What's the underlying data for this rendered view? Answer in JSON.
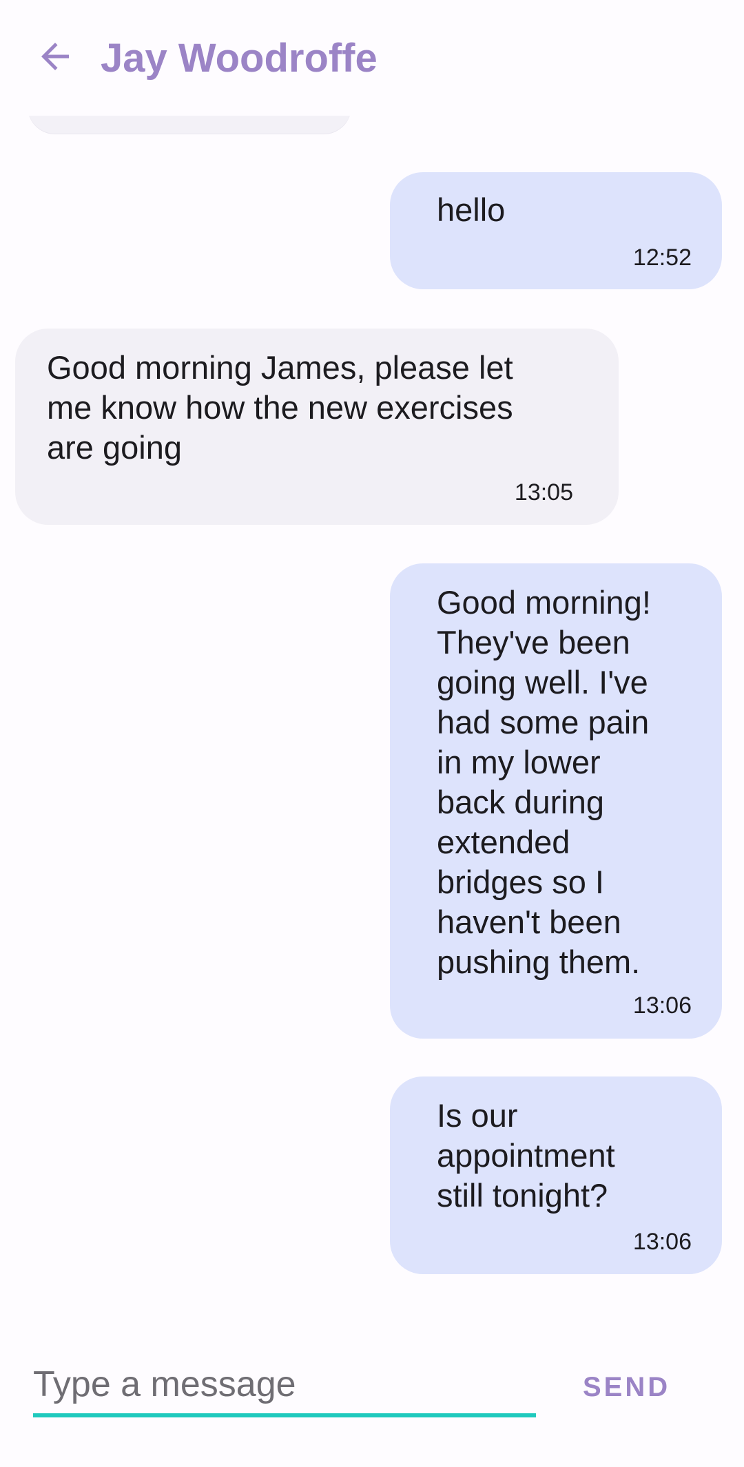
{
  "header": {
    "back_icon": "arrow-back-icon",
    "contact_name": "Jay Woodroffe",
    "accent_color": "#9b84c6"
  },
  "messages": [
    {
      "direction": "sent",
      "text": "hello",
      "time": "12:52"
    },
    {
      "direction": "received",
      "text": "Good morning James, please let\nme know how the new exercises\nare going",
      "time": "13:05"
    },
    {
      "direction": "sent",
      "text": "Good morning!\nThey've been\ngoing well. I've\nhad some pain\nin my lower\nback during\nextended\nbridges so I\nhaven't been\npushing them.",
      "time": "13:06"
    },
    {
      "direction": "sent",
      "text": "Is our\nappointment\nstill tonight?",
      "time": "13:06"
    }
  ],
  "composer": {
    "placeholder": "Type a message",
    "value": "",
    "send_label": "SEND",
    "underline_color": "#1fc9bd"
  }
}
